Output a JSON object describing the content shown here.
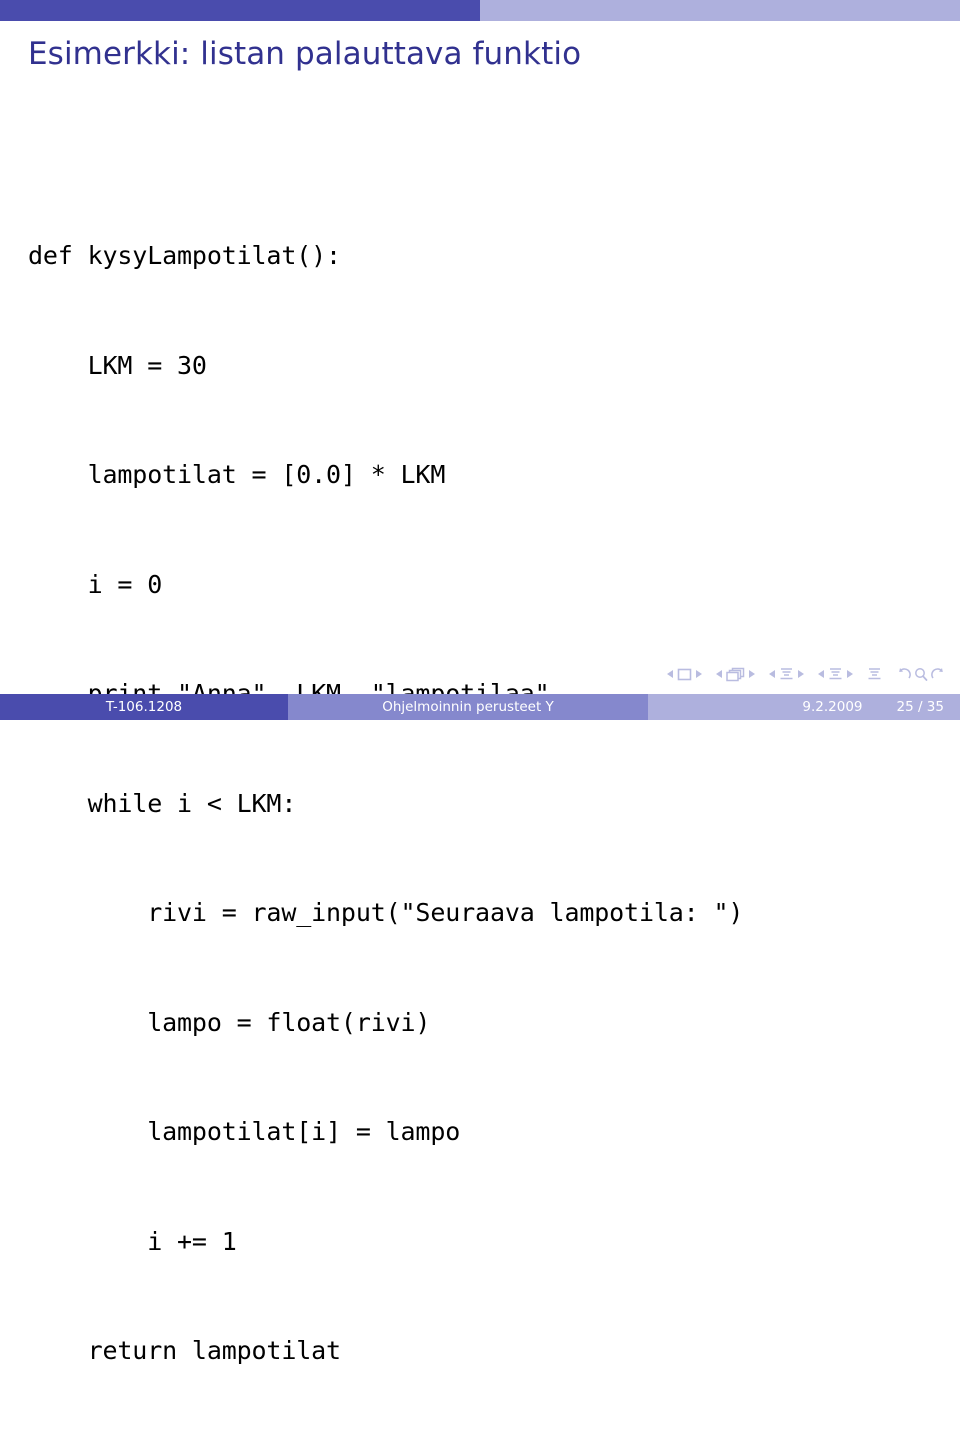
{
  "slide": {
    "title": "Esimerkki: listan palauttava funktio",
    "code_lines": [
      "def kysyLampotilat():",
      "    LKM = 30",
      "    lampotilat = [0.0] * LKM",
      "    i = 0",
      "    print \"Anna\", LKM, \"lampotilaa\"",
      "    while i < LKM:",
      "        rivi = raw_input(\"Seuraava lampotila: \")",
      "        lampo = float(rivi)",
      "        lampotilat[i] = lampo",
      "        i += 1",
      "    return lampotilat"
    ]
  },
  "footer": {
    "course_code": "T-106.1208",
    "course_name": "Ohjelmoinnin perusteet Y",
    "date": "9.2.2009",
    "page": "25 / 35"
  },
  "navigation": {
    "slide_icon": "slide-nav-icon",
    "frame_icon": "frame-nav-icon",
    "subsection_icon": "subsection-nav-icon",
    "section_icon": "section-nav-icon",
    "presentation_icon": "presentation-nav-icon",
    "back_icon": "back-nav-icon",
    "search_icon": "search-nav-icon",
    "forward_icon": "forward-nav-icon"
  },
  "colors": {
    "header_dark": "#4a4cad",
    "header_light": "#aeb0dd",
    "footer_mid": "#8588cd",
    "title_text": "#31318f",
    "nav_symbols": "#b9bce0",
    "code_text": "#000000",
    "background": "#ffffff"
  }
}
